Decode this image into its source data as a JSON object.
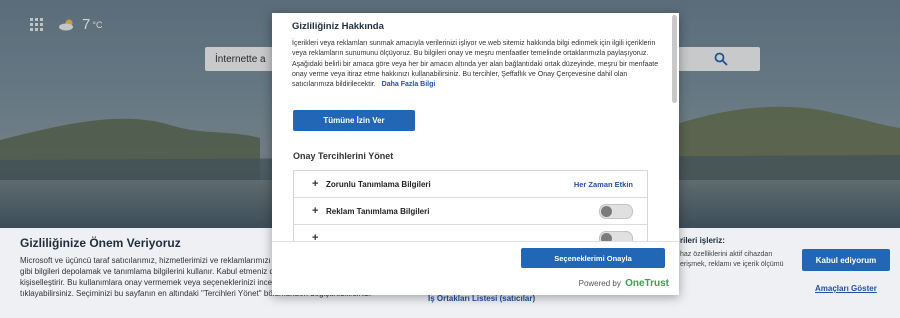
{
  "background": {
    "weather_temp": "7",
    "weather_unit": "°C",
    "search_placeholder": "İnternette a"
  },
  "banner": {
    "title": "Gizliliğinize Önem Veriyoruz",
    "body": "Microsoft ve üçüncü taraf satıcılarımız, hizmetlerimizi ve reklamlarımızı iyileştirmek amacıyla benzersiz kimlikler gibi bilgileri depolamak ve tanımlama bilgilerini kullanır. Kabul etmeniz durumunda MSN içeriği ve reklamları kişiselleştirir. Bu kullanımlara onay vermemek veya seçeneklerinizi incelemek için \"Tercihleri yönet\" seçeneğine tıklayabilirsiniz. Seçiminizi bu sayfanın en altındaki \"Tercihleri Yönet\" bölümünden değiştirebilirsiniz.",
    "right_heading": "rileri işleriz:",
    "right_body": "haz özelliklerini aktif cihazdan erişmek, reklamı ve içerik ölçümü",
    "partners_link": "İş Ortakları Listesi (satıcılar)",
    "accept_label": "Kabul ediyorum",
    "purposes_link": "Amaçları Göster"
  },
  "modal": {
    "title": "Gizliliğiniz Hakkında",
    "text": "İçerikleri veya reklamları sunmak amacıyla verilerinizi işliyor ve web sitemiz hakkında bilgi edinmek için ilgili içeriklerin veya reklamların sunumunu ölçüyoruz. Bu bilgileri onay ve meşru menfaatler temelinde ortaklarımızla paylaşıyoruz. Aşağıdaki belirli bir amaca göre veya her bir amacın altında yer alan bağlantıdaki ortak düzeyinde, meşru bir menfaate onay verme veya itiraz etme hakkınızı kullanabilirsiniz. Bu tercihler, Şeffaflık ve Onay Çerçevesine dahil olan satıcılarımıza bildirilecektir.",
    "more_link": "Daha Fazla Bilgi",
    "allow_all_label": "Tümüne İzin Ver",
    "preferences_title": "Onay Tercihlerini Yönet",
    "categories": [
      {
        "label": "Zorunlu Tanımlama Bilgileri",
        "status": "Her Zaman Etkin"
      },
      {
        "label": "Reklam Tanımlama Bilgileri",
        "toggle": false
      },
      {
        "label": "",
        "toggle": false
      }
    ],
    "confirm_label": "Seçeneklerimi Onayla",
    "powered_by": "Powered by",
    "brand": "OneTrust"
  },
  "colors": {
    "accent": "#2266b6",
    "link": "#2151a8",
    "brand_green": "#3aa34a"
  }
}
